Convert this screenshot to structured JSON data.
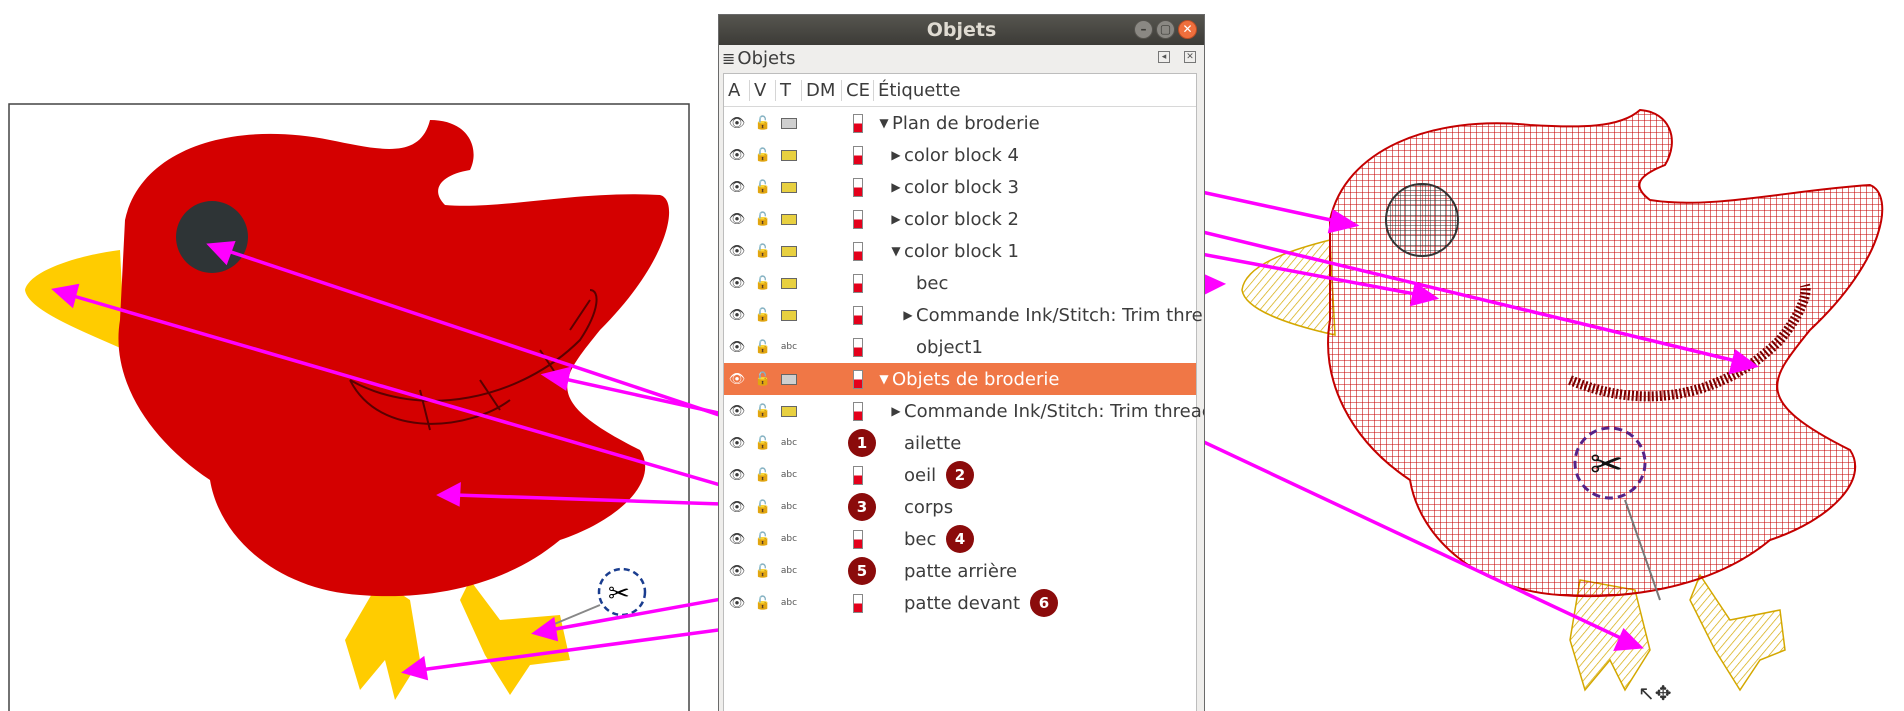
{
  "window": {
    "title": "Objets",
    "dock_title": "Objets",
    "buttons": [
      "–",
      "▢",
      "✕"
    ]
  },
  "columns": [
    "A",
    "V",
    "T",
    "DM",
    "CE",
    "Étiquette"
  ],
  "rows": [
    {
      "label": "Plan de broderie",
      "indent": 0,
      "arrow": "down",
      "type": "group",
      "selected": false
    },
    {
      "label": "color block 4",
      "indent": 1,
      "arrow": "right",
      "type": "shape",
      "selected": false
    },
    {
      "label": "color block 3",
      "indent": 1,
      "arrow": "right",
      "type": "shape",
      "selected": false
    },
    {
      "label": "color block 2",
      "indent": 1,
      "arrow": "right",
      "type": "shape",
      "selected": false
    },
    {
      "label": "color block 1",
      "indent": 1,
      "arrow": "down",
      "type": "shape",
      "selected": false
    },
    {
      "label": "bec",
      "indent": 2,
      "arrow": "",
      "type": "shape",
      "selected": false
    },
    {
      "label": "Commande Ink/Stitch: Trim thre",
      "indent": 2,
      "arrow": "right",
      "type": "shape",
      "selected": false
    },
    {
      "label": "object1",
      "indent": 2,
      "arrow": "",
      "type": "text",
      "selected": false
    },
    {
      "label": "Objets de broderie",
      "indent": 0,
      "arrow": "down",
      "type": "group",
      "selected": true
    },
    {
      "label": "Commande Ink/Stitch: Trim threac",
      "indent": 1,
      "arrow": "right",
      "type": "shape",
      "selected": false
    },
    {
      "label": "ailette",
      "indent": 1,
      "arrow": "",
      "type": "text",
      "selected": false
    },
    {
      "label": "oeil",
      "indent": 1,
      "arrow": "",
      "type": "text",
      "selected": false
    },
    {
      "label": "corps",
      "indent": 1,
      "arrow": "",
      "type": "text",
      "selected": false
    },
    {
      "label": "bec",
      "indent": 1,
      "arrow": "",
      "type": "text",
      "selected": false
    },
    {
      "label": "patte arrière",
      "indent": 1,
      "arrow": "",
      "type": "text",
      "selected": false
    },
    {
      "label": "patte devant",
      "indent": 1,
      "arrow": "",
      "type": "text",
      "selected": false
    }
  ],
  "badges": [
    {
      "n": "1",
      "row": 10
    },
    {
      "n": "2",
      "row": 11
    },
    {
      "n": "3",
      "row": 12
    },
    {
      "n": "4",
      "row": 13
    },
    {
      "n": "5",
      "row": 14
    },
    {
      "n": "6",
      "row": 15
    }
  ],
  "icons": {
    "visible": "eye-icon",
    "lock": "lock-icon",
    "trim": "scissors-icon"
  },
  "colors": {
    "bird_red": "#d40000",
    "beak_yellow": "#ffcc00",
    "eye": "#2e3436",
    "arrow": "#ff00ff",
    "selected_row": "#f07746",
    "badge": "#8b0b0b",
    "stitch_red": "#cc1111",
    "stitch_yellow": "#e8c300"
  }
}
